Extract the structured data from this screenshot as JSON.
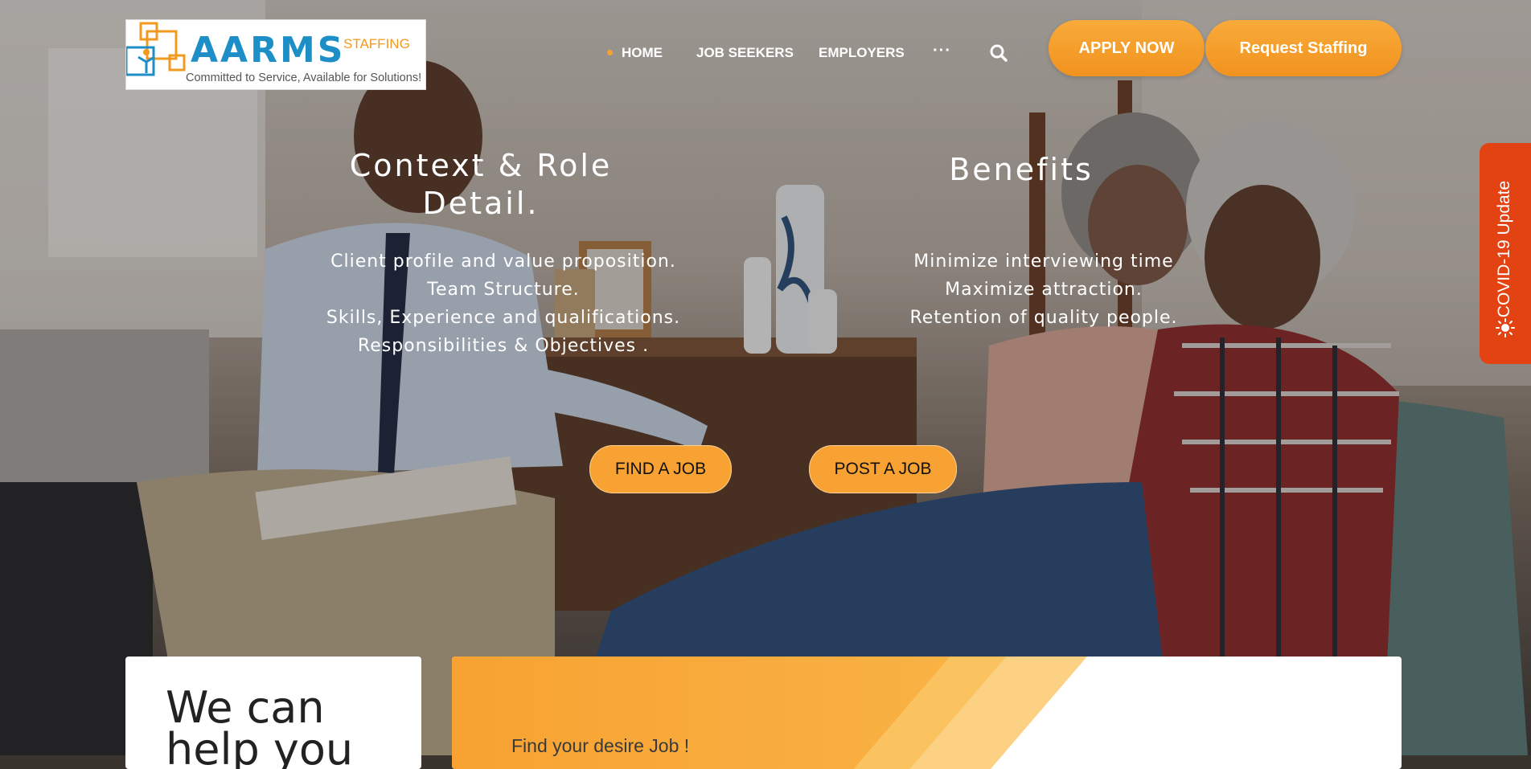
{
  "logo": {
    "brand": "AARMS",
    "sub": "STAFFING",
    "tagline": "Committed to Service, Available for Solutions!"
  },
  "nav": {
    "items": [
      "HOME",
      "JOB SEEKERS",
      "EMPLOYERS"
    ],
    "more": "···",
    "search_icon": "search-icon"
  },
  "header_buttons": {
    "apply": "APPLY NOW",
    "request": "Request Staffing"
  },
  "covid_tab": {
    "label": "COVID-19 Update",
    "icon": "sun-icon"
  },
  "context": {
    "title_line1": "Context & Role",
    "title_line2": "Detail.",
    "lines": [
      "Client profile and value proposition.",
      "Team Structure.",
      "Skills, Experience and qualifications.",
      "Responsibilities & Objectives ."
    ]
  },
  "benefits": {
    "title": "Benefits",
    "lines": [
      "Minimize interviewing time",
      "Maximize attraction.",
      "Retention of quality people."
    ]
  },
  "cta": {
    "find": "FIND A JOB",
    "post": "POST A JOB"
  },
  "help_card": {
    "line1": "We can",
    "line2": "help you"
  },
  "find_card": {
    "label": "Find your desire Job !"
  },
  "colors": {
    "accent": "#f7a232",
    "covid": "#e34313",
    "brand_blue": "#1e8fc6"
  }
}
